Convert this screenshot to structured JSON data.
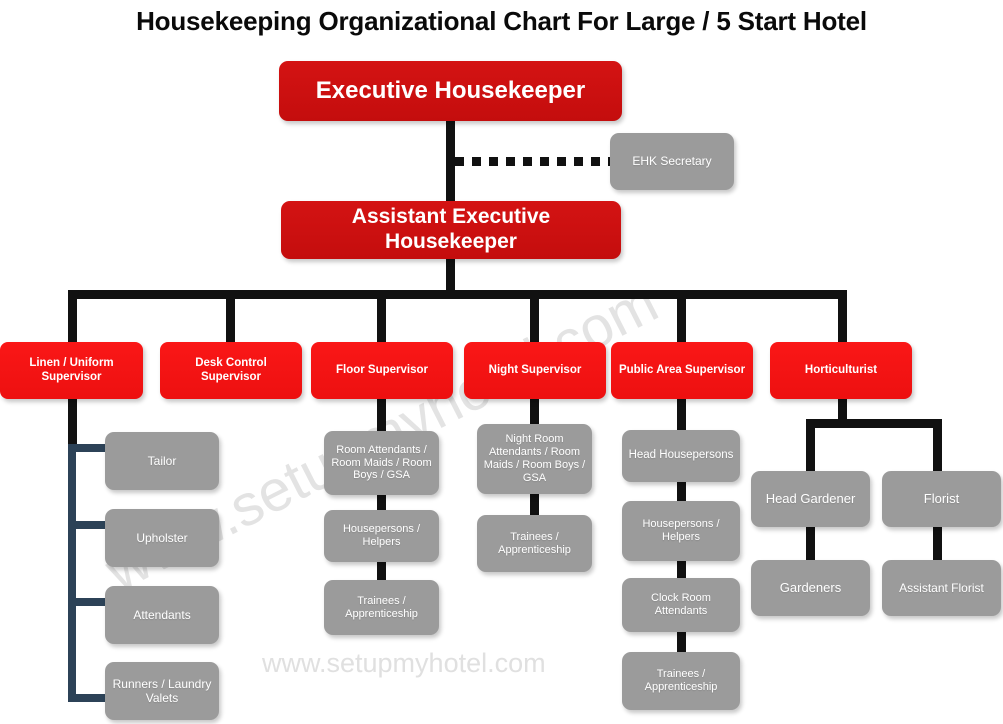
{
  "title": "Housekeeping Organizational Chart For Large / 5 Start Hotel",
  "watermark": {
    "diagonal": "www.setupmyhotel.com",
    "flat": "www.setupmyhotel.com"
  },
  "nodes": {
    "executive_housekeeper": "Executive Housekeeper",
    "ehk_secretary": "EHK Secretary",
    "assistant_executive_housekeeper": "Assistant Executive Housekeeper",
    "linen_uniform_supervisor": "Linen / Uniform Supervisor",
    "desk_control_supervisor": "Desk Control Supervisor",
    "floor_supervisor": "Floor Supervisor",
    "night_supervisor": "Night Supervisor",
    "public_area_supervisor": "Public Area Supervisor",
    "horticulturist": "Horticulturist",
    "tailor": "Tailor",
    "upholster": "Upholster",
    "attendants": "Attendants",
    "runners_laundry_valets": "Runners / Laundry Valets",
    "floor_room_attendants": "Room Attendants / Room Maids / Room Boys / GSA",
    "floor_housepersons": "Housepersons / Helpers",
    "floor_trainees": "Trainees / Apprenticeship",
    "night_room_attendants": "Night Room Attendants / Room Maids / Room Boys / GSA",
    "night_trainees": "Trainees / Apprenticeship",
    "head_housepersons": "Head Housepersons",
    "public_housepersons": "Housepersons / Helpers",
    "clock_room_attendants": "Clock Room Attendants",
    "public_trainees": "Trainees / Apprenticeship",
    "head_gardener": "Head Gardener",
    "florist": "Florist",
    "gardeners": "Gardeners",
    "assistant_florist": "Assistant Florist"
  },
  "chart_data": {
    "type": "diagram",
    "diagram_type": "organizational-chart",
    "title": "Housekeeping Organizational Chart For Large / 5 Start Hotel",
    "colors": {
      "top_level_box": "#cc1111",
      "supervisor_box": "#f41414",
      "staff_box": "#9b9b9b",
      "connector": "#111111",
      "linen_connector": "#2c4257",
      "text_on_box": "#ffffff",
      "title_text": "#0a0a0a",
      "background": "#ffffff",
      "watermark": "#e3e3e3"
    },
    "hierarchy": [
      {
        "label": "Executive Housekeeper",
        "level": 1,
        "style": "red-dark",
        "dotted_staff": [
          "EHK Secretary"
        ],
        "children": [
          {
            "label": "Assistant Executive Housekeeper",
            "level": 2,
            "style": "red-dark",
            "children": [
              {
                "label": "Linen / Uniform Supervisor",
                "level": 3,
                "style": "red-bright",
                "connector": "bracket-left",
                "children": [
                  {
                    "label": "Tailor",
                    "level": 4,
                    "style": "gray"
                  },
                  {
                    "label": "Upholster",
                    "level": 4,
                    "style": "gray"
                  },
                  {
                    "label": "Attendants",
                    "level": 4,
                    "style": "gray"
                  },
                  {
                    "label": "Runners / Laundry Valets",
                    "level": 4,
                    "style": "gray"
                  }
                ]
              },
              {
                "label": "Desk Control Supervisor",
                "level": 3,
                "style": "red-bright",
                "children": []
              },
              {
                "label": "Floor Supervisor",
                "level": 3,
                "style": "red-bright",
                "connector": "vertical-chain",
                "children": [
                  {
                    "label": "Room Attendants / Room Maids / Room Boys / GSA",
                    "level": 4,
                    "style": "gray"
                  },
                  {
                    "label": "Housepersons / Helpers",
                    "level": 5,
                    "style": "gray"
                  },
                  {
                    "label": "Trainees / Apprenticeship",
                    "level": 6,
                    "style": "gray"
                  }
                ]
              },
              {
                "label": "Night Supervisor",
                "level": 3,
                "style": "red-bright",
                "connector": "vertical-chain",
                "children": [
                  {
                    "label": "Night Room Attendants / Room Maids / Room Boys / GSA",
                    "level": 4,
                    "style": "gray"
                  },
                  {
                    "label": "Trainees / Apprenticeship",
                    "level": 5,
                    "style": "gray"
                  }
                ]
              },
              {
                "label": "Public Area Supervisor",
                "level": 3,
                "style": "red-bright",
                "connector": "vertical-chain",
                "children": [
                  {
                    "label": "Head Housepersons",
                    "level": 4,
                    "style": "gray"
                  },
                  {
                    "label": "Housepersons / Helpers",
                    "level": 5,
                    "style": "gray"
                  },
                  {
                    "label": "Clock Room Attendants",
                    "level": 6,
                    "style": "gray"
                  },
                  {
                    "label": "Trainees / Apprenticeship",
                    "level": 7,
                    "style": "gray"
                  }
                ]
              },
              {
                "label": "Horticulturist",
                "level": 3,
                "style": "red-bright",
                "connector": "split-two",
                "children": [
                  {
                    "label": "Head Gardener",
                    "level": 4,
                    "style": "gray",
                    "children": [
                      {
                        "label": "Gardeners",
                        "level": 5,
                        "style": "gray"
                      }
                    ]
                  },
                  {
                    "label": "Florist",
                    "level": 4,
                    "style": "gray",
                    "children": [
                      {
                        "label": "Assistant Florist",
                        "level": 5,
                        "style": "gray"
                      }
                    ]
                  }
                ]
              }
            ]
          }
        ]
      }
    ],
    "node_count": 26,
    "levels": 7
  }
}
